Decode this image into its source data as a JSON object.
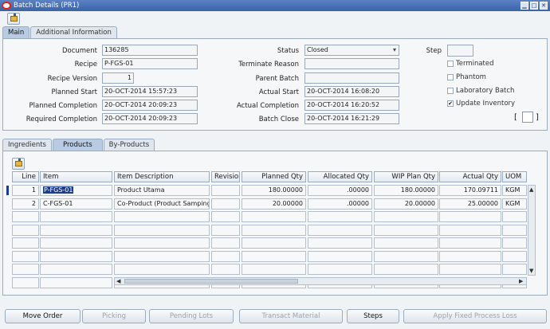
{
  "window": {
    "title": "Batch Details (PR1)"
  },
  "main_tabs": [
    {
      "label": "Main",
      "active": true
    },
    {
      "label": "Additional Information",
      "active": false
    }
  ],
  "header": {
    "document_label": "Document",
    "document_value": "136285",
    "recipe_label": "Recipe",
    "recipe_value": "P-FGS-01",
    "recipe_version_label": "Recipe Version",
    "recipe_version_value": "1",
    "planned_start_label": "Planned Start",
    "planned_start_value": "20-OCT-2014 15:57:23",
    "planned_completion_label": "Planned Completion",
    "planned_completion_value": "20-OCT-2014 20:09:23",
    "required_completion_label": "Required Completion",
    "required_completion_value": "20-OCT-2014 20:09:23",
    "status_label": "Status",
    "status_value": "Closed",
    "terminate_reason_label": "Terminate Reason",
    "terminate_reason_value": "",
    "parent_batch_label": "Parent Batch",
    "parent_batch_value": "",
    "actual_start_label": "Actual Start",
    "actual_start_value": "20-OCT-2014 16:08:20",
    "actual_completion_label": "Actual Completion",
    "actual_completion_value": "20-OCT-2014 16:20:52",
    "batch_close_label": "Batch Close",
    "batch_close_value": "20-OCT-2014 16:21:29",
    "step_label": "Step",
    "step_value": "",
    "terminated_label": "Terminated",
    "terminated_checked": false,
    "phantom_label": "Phantom",
    "phantom_checked": false,
    "laboratory_batch_label": "Laboratory Batch",
    "laboratory_batch_checked": false,
    "update_inventory_label": "Update Inventory",
    "update_inventory_checked": true,
    "bracket_left": "[",
    "bracket_right": "]",
    "check_mark": "✔"
  },
  "detail_tabs": [
    {
      "label": "Ingredients",
      "active": false
    },
    {
      "label": "Products",
      "active": true
    },
    {
      "label": "By-Products",
      "active": false
    }
  ],
  "grid": {
    "columns": [
      "Line",
      "Item",
      "Item Description",
      "Revision",
      "Planned Qty",
      "Allocated Qty",
      "WIP Plan Qty",
      "Actual Qty",
      "UOM"
    ],
    "rows": [
      {
        "line": "1",
        "item": "P-FGS-01",
        "description": "Product Utama",
        "revision": "",
        "planned_qty": "180.00000",
        "allocated_qty": ".00000",
        "wip_plan_qty": "180.00000",
        "actual_qty": "170.09711",
        "uom": "KGM"
      },
      {
        "line": "2",
        "item": "C-FGS-01",
        "description": "Co-Product (Product Samping",
        "revision": "",
        "planned_qty": "20.00000",
        "allocated_qty": ".00000",
        "wip_plan_qty": "20.00000",
        "actual_qty": "25.00000",
        "uom": "KGM"
      }
    ],
    "empty_rows": 6
  },
  "footer_buttons": [
    {
      "label": "Move Order",
      "enabled": true
    },
    {
      "label": "Picking",
      "enabled": false
    },
    {
      "label": "Pending Lots",
      "enabled": false
    },
    {
      "label": "Transact Material",
      "enabled": false
    },
    {
      "label": "Steps",
      "enabled": true
    },
    {
      "label": "Apply Fixed Process Loss",
      "enabled": false
    }
  ]
}
